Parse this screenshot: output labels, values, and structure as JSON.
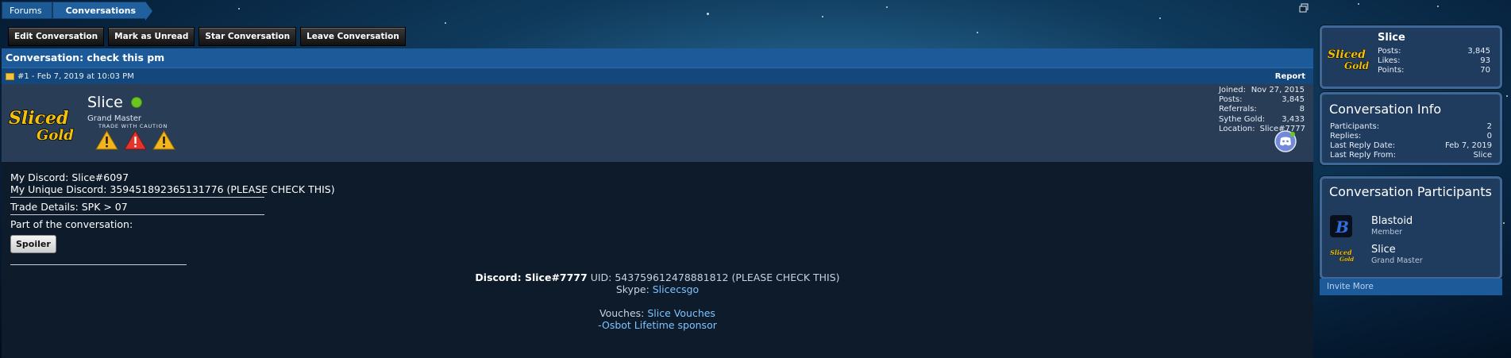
{
  "breadcrumb": {
    "items": [
      "Forums",
      "Conversations"
    ]
  },
  "toolbar": {
    "buttons": [
      "Edit Conversation",
      "Mark as Unread",
      "Star Conversation",
      "Leave Conversation"
    ]
  },
  "conversation": {
    "title": "Conversation: check this pm"
  },
  "message": {
    "meta": "#1 - Feb 7, 2019 at 10:03 PM",
    "report": "Report",
    "author": {
      "name": "Slice",
      "rank": "Grand Master",
      "caution_text": "TRADE WITH CAUTION",
      "stats": [
        {
          "label": "Joined:",
          "value": "Nov 27, 2015"
        },
        {
          "label": "Posts:",
          "value": "3,845"
        },
        {
          "label": "Referrals:",
          "value": "8"
        },
        {
          "label": "Sythe Gold:",
          "value": "3,433"
        }
      ],
      "location_label": "Location:",
      "location_value": "Slice#7777"
    },
    "lines": {
      "discord": "My Discord: Slice#6097",
      "unique": "My Unique Discord: 359451892365131776 (PLEASE CHECK THIS)",
      "trade": "Trade Details: SPK > 07",
      "part": "Part of the conversation:",
      "spoiler": "Spoiler"
    },
    "signature": {
      "discord_label": "Discord: Slice#7777",
      "uid": " UID: 543759612478881812 (PLEASE CHECK THIS)",
      "skype_label": "Skype: ",
      "skype_link": "Slicecsgo",
      "vouches_label": "Vouches: ",
      "vouches_link": "Slice Vouches",
      "osbot": "-Osbot Lifetime sponsor"
    }
  },
  "sidebar": {
    "profile": {
      "name": "Slice",
      "stats": [
        {
          "label": "Posts:",
          "value": "3,845"
        },
        {
          "label": "Likes:",
          "value": "93"
        },
        {
          "label": "Points:",
          "value": "70"
        }
      ]
    },
    "info": {
      "title": "Conversation Info",
      "rows": [
        {
          "label": "Participants:",
          "value": "2"
        },
        {
          "label": "Replies:",
          "value": "0"
        },
        {
          "label": "Last Reply Date:",
          "value": "Feb 7, 2019"
        },
        {
          "label": "Last Reply From:",
          "value": "Slice"
        }
      ]
    },
    "participants": {
      "title": "Conversation Participants",
      "list": [
        {
          "name": "Blastoid",
          "rank": "Member"
        },
        {
          "name": "Slice",
          "rank": "Grand Master"
        }
      ]
    },
    "invite": "Invite More"
  },
  "colors": {
    "header_blue": "#1d5a99",
    "panel": "#0d1b2b",
    "link": "#7ec3ff"
  }
}
